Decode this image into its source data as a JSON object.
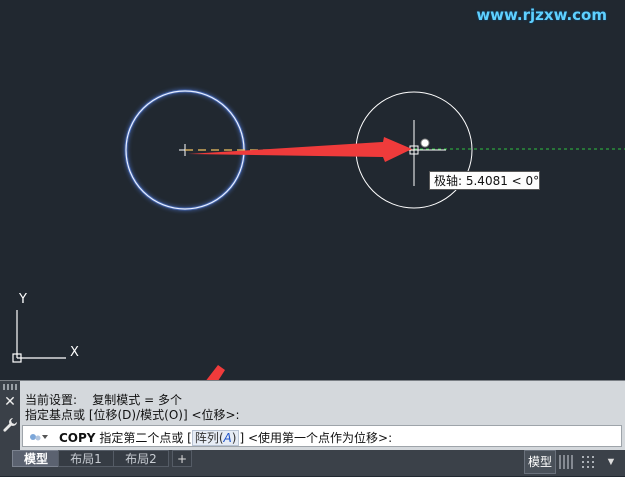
{
  "watermark": "www.rjzxw.com",
  "tooltip": {
    "label": "极轴: 5.4081 < 0°"
  },
  "ucs": {
    "y_label": "Y",
    "x_label": "X"
  },
  "command_window": {
    "history": [
      "当前设置:    复制模式 = 多个",
      "指定基点或 [位移(D)/模式(O)] <位移>:"
    ],
    "prompt_command": "COPY",
    "prompt_text": "指定第二个点或",
    "option_bracket_open": "[",
    "option_label": "阵列(",
    "option_key": "A",
    "option_close": ")",
    "option_bracket_close": "]",
    "prompt_tail": "<使用第一个点作为位移>:"
  },
  "tabs": [
    {
      "label": "模型",
      "active": true
    },
    {
      "label": "布局1",
      "active": false
    },
    {
      "label": "布局2",
      "active": false
    }
  ],
  "add_tab_label": "+",
  "status_bar": {
    "model_label": "模型"
  },
  "colors": {
    "canvas_bg": "#212830",
    "arrow": "#ef3b3b",
    "circle_selected": "#a8c8ff",
    "circle_copy": "#ffffff",
    "rubberband": "#f0c060",
    "polar_track": "#2fbf3f",
    "watermark": "#5fd0ff"
  }
}
